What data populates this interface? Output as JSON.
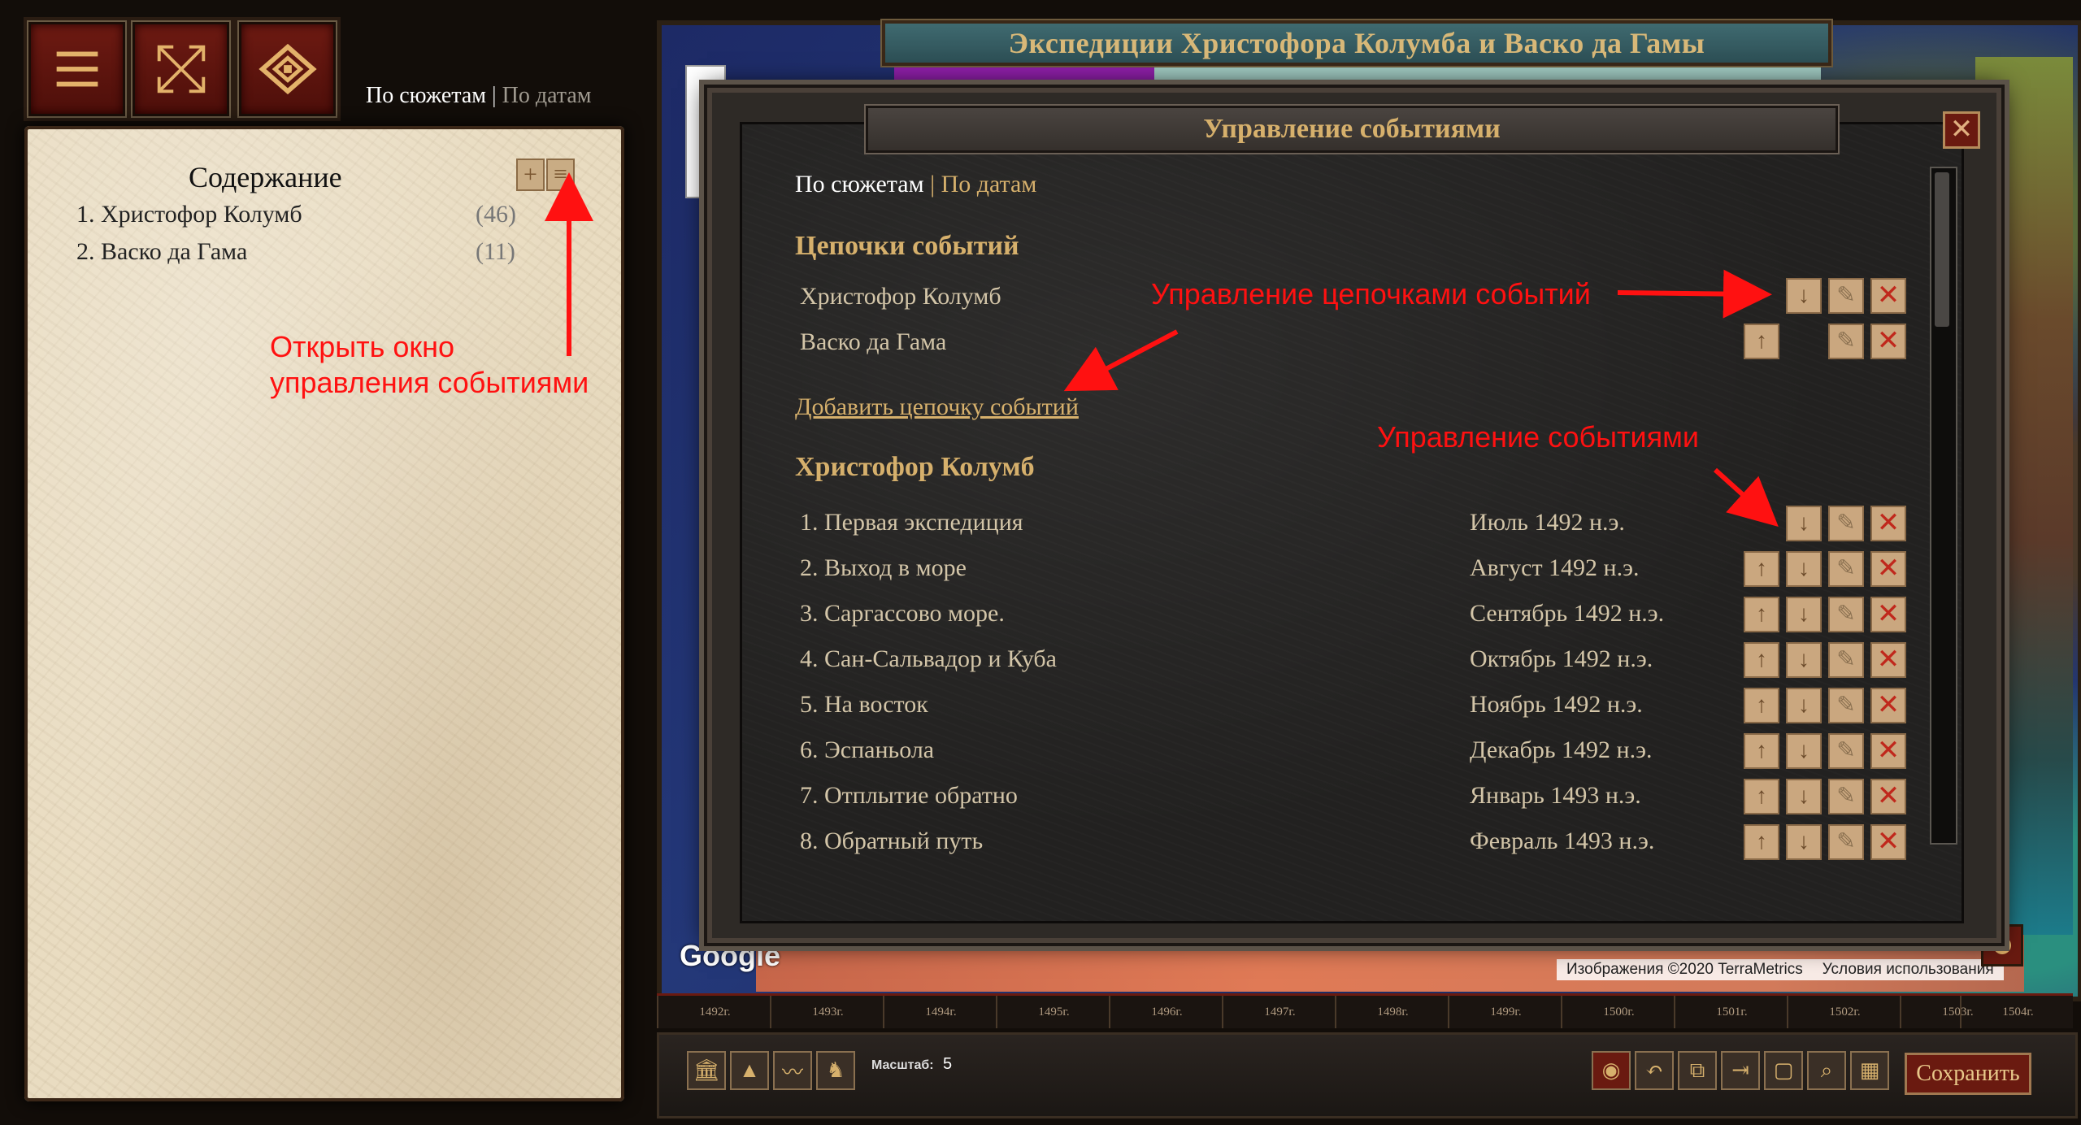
{
  "toolbar": {
    "view_mode": {
      "active": "По сюжетам",
      "separator": "|",
      "inactive": "По датам"
    },
    "icons": [
      "menu-icon",
      "expand-icon",
      "eye-icon"
    ]
  },
  "toc": {
    "title": "Содержание",
    "items": [
      {
        "label": "1. Христофор Колумб",
        "count": "(46)"
      },
      {
        "label": "2. Васко да Гама",
        "count": "(11)"
      }
    ]
  },
  "annotations": {
    "open_window": [
      "Открыть окно",
      "управления событиями"
    ],
    "chain_manage": "Управление цепочками событий",
    "event_manage": "Управление событиями"
  },
  "map": {
    "title": "Экспедиции Христофора Колумба и Васко да Гамы",
    "google": "Google",
    "attribution": "Изображения ©2020 TerraMetrics",
    "terms": "Условия использования"
  },
  "modal": {
    "title": "Управление событиями",
    "close": "✕",
    "view_mode": {
      "active": "По сюжетам",
      "separator": "|",
      "inactive": "По датам"
    },
    "chains_heading": "Цепочки событий",
    "chains": [
      "Христофор Колумб",
      "Васко да Гама"
    ],
    "add_chain": "Добавить цепочку событий",
    "events_heading": "Христофор Колумб",
    "events": [
      {
        "label": "1. Первая экспедиция",
        "date": "Июль 1492 н.э."
      },
      {
        "label": "2. Выход в море",
        "date": "Август 1492 н.э."
      },
      {
        "label": "3. Саргассово море.",
        "date": "Сентябрь 1492 н.э."
      },
      {
        "label": "4. Сан-Сальвадор и Куба",
        "date": "Октябрь 1492 н.э."
      },
      {
        "label": "5. На восток",
        "date": "Ноябрь 1492 н.э."
      },
      {
        "label": "6. Эспаньола",
        "date": "Декабрь 1492 н.э."
      },
      {
        "label": "7. Отплытие обратно",
        "date": "Январь 1493 н.э."
      },
      {
        "label": "8. Обратный путь",
        "date": "Февраль 1493 н.э."
      }
    ]
  },
  "timeline": {
    "years": [
      "1492г.",
      "1493г.",
      "1494г.",
      "1495г.",
      "1496г.",
      "1497г.",
      "1498г.",
      "1499г.",
      "1500г.",
      "1501г.",
      "1502г.",
      "1503г.",
      "1504г."
    ]
  },
  "bottom_bar": {
    "scale_label": "Масштаб:",
    "scale_value": "5",
    "save": "Сохранить"
  }
}
